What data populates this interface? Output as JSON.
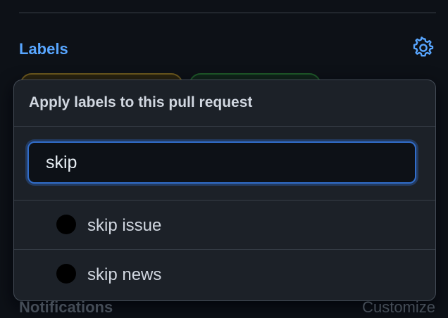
{
  "sidebar": {
    "labels_heading": "Labels",
    "settings_icon": "gear-icon",
    "notifications_heading": "Notifications",
    "customize_link": "Customize"
  },
  "popover": {
    "title": "Apply labels to this pull request",
    "filter": {
      "value": "skip",
      "placeholder": ""
    },
    "items": [
      {
        "label": "skip issue",
        "color": "#000000"
      },
      {
        "label": "skip news",
        "color": "#000000"
      }
    ]
  },
  "colors": {
    "accent": "#58a6ff",
    "focus_border": "#316dca",
    "background": "#0d1117",
    "popover_bg": "#1c2128"
  }
}
